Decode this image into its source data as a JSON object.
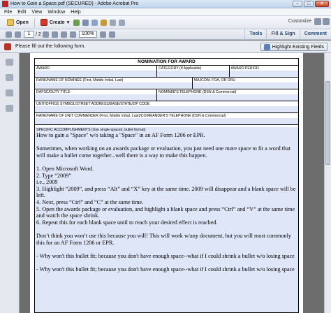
{
  "window": {
    "title": "How to Gain a Space.pdf (SECURED) - Adobe Acrobat Pro",
    "controls": [
      "–",
      "□",
      "✕"
    ]
  },
  "menu": [
    "File",
    "Edit",
    "View",
    "Window",
    "Help"
  ],
  "toolbar": {
    "open_label": "Open",
    "create_label": "Create",
    "customize_label": "Customize",
    "page_current": "1",
    "page_total": "/ 2",
    "zoom": "100%"
  },
  "panes": [
    "Tools",
    "Fill & Sign",
    "Comment"
  ],
  "formbar": {
    "message": "Please fill out the following form.",
    "highlight_label": "Highlight Existing Fields"
  },
  "form": {
    "heading": "NOMINATION FOR AWARD",
    "rows": [
      [
        {
          "label": "AWARD",
          "w": 176
        },
        {
          "label": "CATEGORY (If Applicable)",
          "w": 104
        },
        {
          "label": "AWARD PERIOD",
          "w": 99
        }
      ],
      [
        {
          "label": "RANK/NAME OF NOMINEE (First, Middle Initial, Last)",
          "w": 227
        },
        {
          "label": "MAJCOM, FOA, OR DRU",
          "w": 152
        }
      ],
      [
        {
          "label": "DAFSC/DUTY TITLE",
          "w": 176
        },
        {
          "label": "NOMINEE'S TELEPHONE  (DSN & Commercial)",
          "w": 203
        }
      ],
      [
        {
          "label": "UNIT/OFFICE SYMBOL/STREET ADDRESS/BASE/STATE/ZIP CODE",
          "w": 379
        }
      ],
      [
        {
          "label": "RANK/NAME OF UNIT COMMANDER (First, Middle Initial, Last)/COMMANDER'S TELEPHONE (DSN & Commercial)",
          "w": 379
        }
      ]
    ],
    "accomplishments_label": "SPECIFIC ACCOMPLISHMENTS (Use single-spaced, bullet format)",
    "paragraphs": [
      "How to gain a \"Space\" w/o taking a \"Space\" in an AF Form 1206 or EPR.",
      "",
      "Sometimes, when working on an awards package or evaluation, you just need one more space to fit a word that will make a bullet come together...well there is a way to make this happen.",
      "",
      "1.  Open Microsoft Word.",
      "2.  Type “2009”",
      "          i.e., 2009",
      "3.  Highlight “2009”, and press “Alt” and “X” key at the same time.  2009 will disappear and a blank space will be left.",
      "4.  Next, press “Ctrl” and “C” at the same time.",
      "5.  Open the awards package or evaluation, and highlight a blank space and press “Ctrl” and “V” at the same time and watch the space shrink.",
      "6.  Repeat this for each blank space until to reach your desired effect is reached.",
      "",
      "Don’t think you won’t use this because you will!  This will work w/any document, but you will most commonly this for an AF Form 1206 or EPR.",
      "",
      "- Why won't this bullet fit; because you don't have enough space--what if I could shrink a bullet w/o losing space",
      "",
      "- Why won't this bullet fit; because you don't have enough space--what if I could shrink a bullet w/o losing space"
    ]
  }
}
